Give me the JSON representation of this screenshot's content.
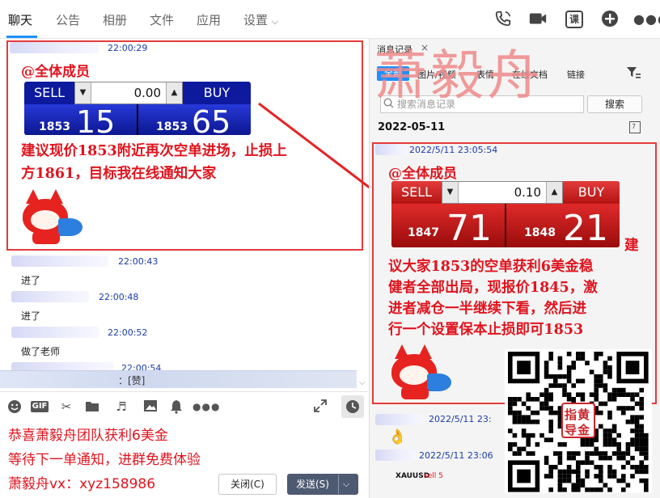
{
  "tabs": [
    {
      "label": "聊天"
    },
    {
      "label": "公告"
    },
    {
      "label": "相册"
    },
    {
      "label": "文件"
    },
    {
      "label": "应用"
    },
    {
      "label": "设置"
    }
  ],
  "top_icons": {
    "phone": "phone-icon",
    "video": "video-icon",
    "course_label": "课",
    "add": "add-icon",
    "more": "more-icon"
  },
  "chat": {
    "msg1": {
      "time": "22:00:29",
      "mention": "@全体成员",
      "widget": {
        "sell": "SELL",
        "buy": "BUY",
        "value": "0.00",
        "sell_small": "1853",
        "sell_big": "15",
        "buy_small": "1853",
        "buy_big": "65"
      },
      "text_line1": "建议现价1853附近再次空单进场，止损上",
      "text_line2": "方1861，目标我在线通知大家"
    },
    "msg2": {
      "time": "22:00:43",
      "text": "进了"
    },
    "msg3": {
      "time": "22:00:48",
      "text": "进了"
    },
    "msg4": {
      "time": "22:00:52",
      "text": "做了老师"
    },
    "msg5": {
      "time": "22:00:54"
    },
    "reaction_bar": "：[赞]"
  },
  "composer": {
    "tools": [
      "emoji-icon",
      "gif-icon",
      "scissors-icon",
      "folder-icon",
      "music-icon",
      "image-icon",
      "bell-icon",
      "more-icon"
    ],
    "gif_label": "GIF",
    "overlay_line1": "恭喜萧毅舟团队获利6美金",
    "overlay_line2": "等待下一单通知，进群免费体验",
    "overlay_line3": "萧毅舟vx：xyz158986",
    "close_button": "关闭(C)",
    "send_button": "发送(S)"
  },
  "history": {
    "title": "消息记录",
    "close": "×",
    "tabs": [
      "全部",
      "图片/视频",
      "表情",
      "在线文档",
      "链接"
    ],
    "search_placeholder": "搜索消息记录",
    "search_button": "搜索",
    "date": "2022-05-11",
    "msg1": {
      "time": "2022/5/11 23:05:54",
      "mention": "@全体成员",
      "widget": {
        "sell": "SELL",
        "buy": "BUY",
        "value": "0.10",
        "sell_small": "1847",
        "sell_big": "71",
        "buy_small": "1848",
        "buy_big": "21"
      },
      "text": [
        "建",
        "议大家1853的空单获利6美金稳",
        "健者全部出局，现报价1845，激",
        "进者减仓一半继续下看，然后进",
        "行一个设置保本止损即可1853"
      ]
    },
    "msg2": {
      "time": "2022/5/11 23:"
    },
    "msg3": {
      "time": "2022/5/11 23:06"
    },
    "ticker": "XAUUSD",
    "ticker_side": "sell 5"
  },
  "watermark": "萧毅舟",
  "seal": {
    "line1": "指黄",
    "line2": "导金"
  },
  "colors": {
    "accent": "#1e90ff",
    "red": "#e0141e",
    "frame": "#e53a3a",
    "watermark": "#f08a8a"
  }
}
